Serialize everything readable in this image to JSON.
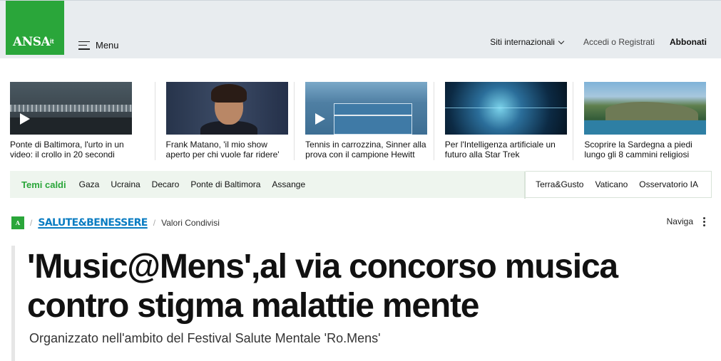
{
  "header": {
    "logo_text": "ANSA",
    "logo_sup": "it",
    "menu_label": "Menu",
    "siti_label": "Siti internazionali",
    "accedi_label": "Accedi o Registrati",
    "abbonati_label": "Abbonati"
  },
  "news": [
    {
      "title": "Ponte di Baltimora, l'urto in un video: il crollo in 20 secondi",
      "has_video": true
    },
    {
      "title": "Frank Matano, 'il mio show aperto per chi vuole far ridere'",
      "has_video": false
    },
    {
      "title": "Tennis in carrozzina, Sinner alla prova con il campione Hewitt",
      "has_video": true
    },
    {
      "title": "Per l'Intelligenza artificiale un futuro alla Star Trek",
      "has_video": false
    },
    {
      "title": "Scoprire la Sardegna a piedi lungo gli 8 cammini religiosi",
      "has_video": false
    }
  ],
  "temi": {
    "title": "Temi caldi",
    "left": [
      "Gaza",
      "Ucraina",
      "Decaro",
      "Ponte di Baltimora",
      "Assange"
    ],
    "right": [
      "Terra&Gusto",
      "Vaticano",
      "Osservatorio IA"
    ]
  },
  "breadcrumb": {
    "logo_text": "A",
    "section": "SALUTE&BENESSERE",
    "sub": "Valori Condivisi",
    "naviga": "Naviga"
  },
  "article": {
    "headline": "'Music@Mens',al via concorso musica contro stigma malattie mente",
    "subtitle": "Organizzato nell'ambito del Festival Salute Mentale 'Ro.Mens'"
  },
  "colors": {
    "brand_green": "#2aa63a",
    "section_blue": "#0a7cc2",
    "header_bg": "#e8ecef",
    "temi_bg": "#eef5ee"
  }
}
